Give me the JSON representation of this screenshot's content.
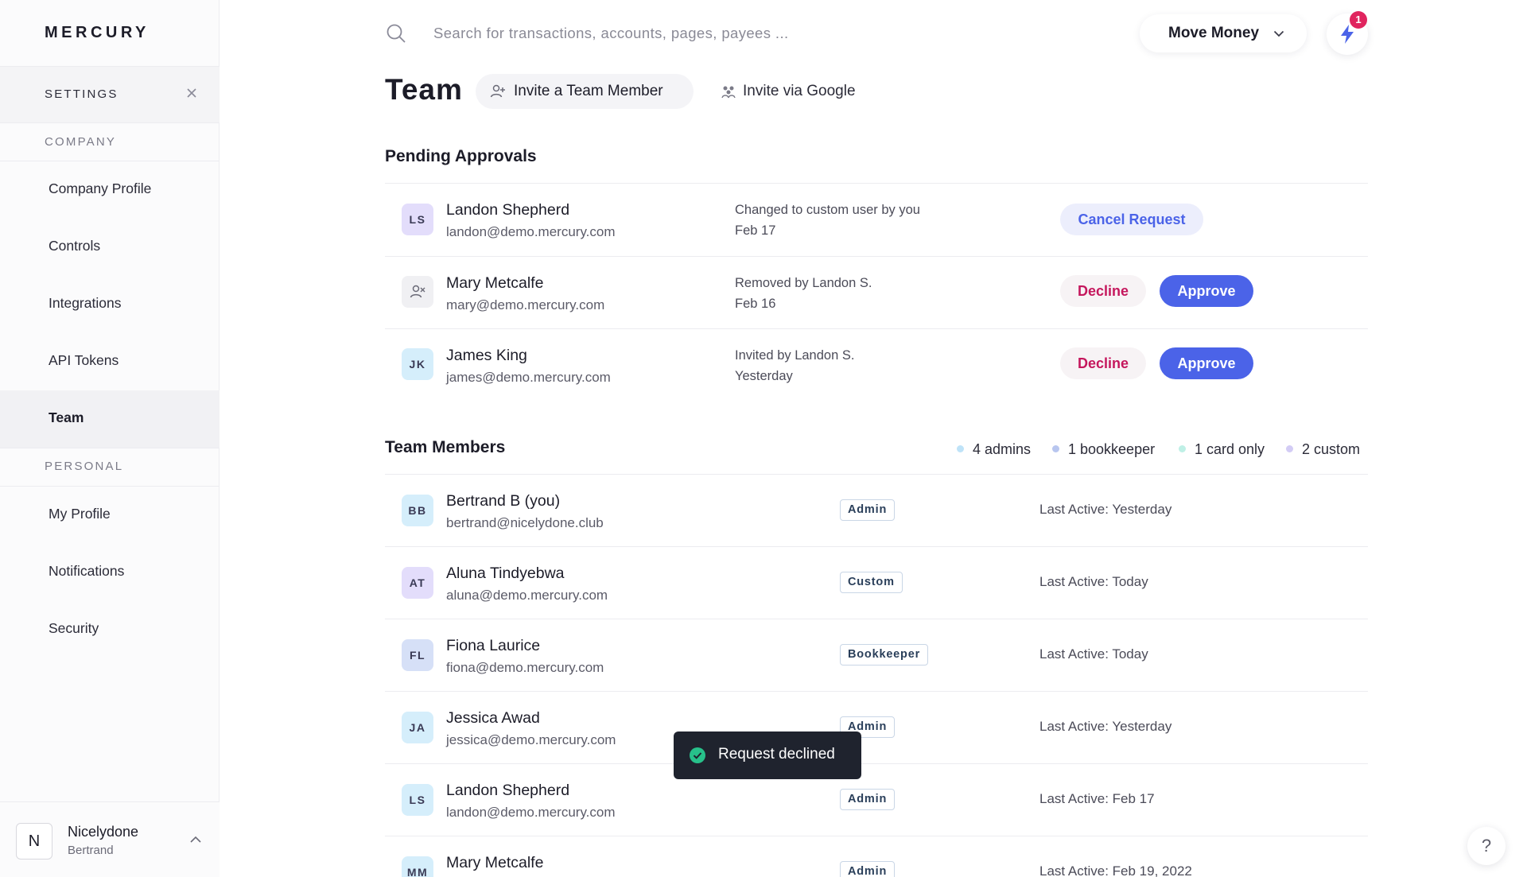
{
  "sidebar": {
    "logo": "MERCURY",
    "settings_label": "SETTINGS",
    "company_label": "COMPANY",
    "personal_label": "PERSONAL",
    "company_items": [
      {
        "label": "Company Profile"
      },
      {
        "label": "Controls"
      },
      {
        "label": "Integrations"
      },
      {
        "label": "API Tokens"
      },
      {
        "label": "Team"
      }
    ],
    "personal_items": [
      {
        "label": "My Profile"
      },
      {
        "label": "Notifications"
      },
      {
        "label": "Security"
      }
    ],
    "active_item": "Team",
    "org": {
      "initial": "N",
      "name": "Nicelydone",
      "user": "Bertrand"
    }
  },
  "topbar": {
    "search_placeholder": "Search for transactions, accounts, pages, payees ...",
    "move_money_label": "Move Money",
    "notification_count": "1"
  },
  "page": {
    "title": "Team",
    "invite_label": "Invite a Team Member",
    "invite_google_label": "Invite via Google"
  },
  "pending": {
    "title": "Pending Approvals",
    "items": [
      {
        "initials": "LS",
        "name": "Landon Shepherd",
        "email": "landon@demo.mercury.com",
        "action": "Changed to custom user by you",
        "date": "Feb 17",
        "cancel_label": "Cancel Request"
      },
      {
        "initials": "",
        "name": "Mary Metcalfe",
        "email": "mary@demo.mercury.com",
        "action": "Removed by Landon S.",
        "date": "Feb 16",
        "decline_label": "Decline",
        "approve_label": "Approve"
      },
      {
        "initials": "JK",
        "name": "James King",
        "email": "james@demo.mercury.com",
        "action": "Invited by Landon S.",
        "date": "Yesterday",
        "decline_label": "Decline",
        "approve_label": "Approve"
      }
    ]
  },
  "members": {
    "title": "Team Members",
    "legend": [
      {
        "label": "4 admins",
        "color": "#bfe3f8"
      },
      {
        "label": "1 bookkeeper",
        "color": "#b8c6ef"
      },
      {
        "label": "1 card only",
        "color": "#bff0e6"
      },
      {
        "label": "2 custom",
        "color": "#d3ccf5"
      }
    ],
    "items": [
      {
        "initials": "BB",
        "name": "Bertrand B (you)",
        "email": "bertrand@nicelydone.club",
        "role": "Admin",
        "last_active": "Last Active: Yesterday"
      },
      {
        "initials": "AT",
        "name": "Aluna Tindyebwa",
        "email": "aluna@demo.mercury.com",
        "role": "Custom",
        "last_active": "Last Active: Today"
      },
      {
        "initials": "FL",
        "name": "Fiona Laurice",
        "email": "fiona@demo.mercury.com",
        "role": "Bookkeeper",
        "last_active": "Last Active: Today"
      },
      {
        "initials": "JA",
        "name": "Jessica Awad",
        "email": "jessica@demo.mercury.com",
        "role": "Admin",
        "last_active": "Last Active: Yesterday"
      },
      {
        "initials": "LS",
        "name": "Landon Shepherd",
        "email": "landon@demo.mercury.com",
        "role": "Admin",
        "last_active": "Last Active: Feb 17"
      },
      {
        "initials": "MM",
        "name": "Mary Metcalfe",
        "email": "",
        "role": "Admin",
        "last_active": "Last Active: Feb 19, 2022"
      }
    ]
  },
  "toast": {
    "message": "Request declined"
  },
  "help": {
    "label": "?"
  },
  "colors": {
    "accent": "#4b63e8",
    "decline": "#c5175d",
    "badge": "#e0245e",
    "toast_bg": "#1f232e",
    "success": "#27c08a"
  }
}
